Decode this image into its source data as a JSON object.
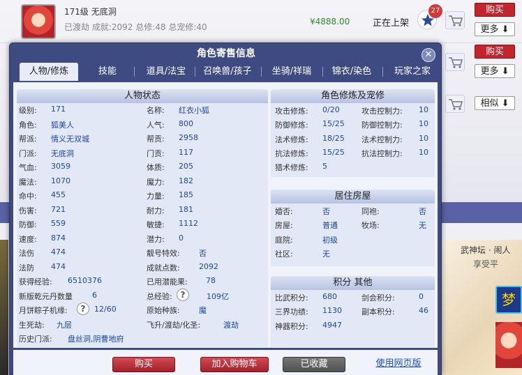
{
  "listing": {
    "title": "171级  无底洞",
    "subtitle": "已渡劫  成就:2092  总修:48  总宠修:40",
    "price": "¥4888.00",
    "status": "正在上架",
    "star_badge": "27",
    "buttons": {
      "buy": "购买",
      "more": "更多",
      "buy2": "购买",
      "more2": "更多",
      "similar": "相似"
    },
    "art_text_1": "武神坛 · 闹人",
    "art_text_2": "享受平",
    "art_icon": "梦"
  },
  "dialog": {
    "title": "角色寄售信息",
    "tabs": [
      "人物/修炼",
      "技能",
      "道具/法宝",
      "召唤兽/孩子",
      "坐骑/祥瑞",
      "锦衣/染色",
      "玩家之家"
    ],
    "active_tab": 0
  },
  "person": {
    "header": "人物状态",
    "left_rows": [
      {
        "label": "级别:",
        "value": "171"
      },
      {
        "label": "角色:",
        "value": "狐美人"
      },
      {
        "label": "帮派:",
        "value": "情义无双城"
      },
      {
        "label": "门派:",
        "value": "无底洞"
      },
      {
        "label": "气血:",
        "value": "3059"
      },
      {
        "label": "魔法:",
        "value": "1070"
      },
      {
        "label": "命中:",
        "value": "455"
      },
      {
        "label": "伤害:",
        "value": "721"
      },
      {
        "label": "防御:",
        "value": "559"
      },
      {
        "label": "速度:",
        "value": "874"
      },
      {
        "label": "法伤",
        "value": "474"
      },
      {
        "label": "法防",
        "value": "474"
      }
    ],
    "right_rows": [
      {
        "label": "名称:",
        "value": "红衣小狐"
      },
      {
        "label": "人气:",
        "value": "800"
      },
      {
        "label": "帮贡:",
        "value": "2958"
      },
      {
        "label": "门贡:",
        "value": "117"
      },
      {
        "label": "体质:",
        "value": "205"
      },
      {
        "label": "魔力:",
        "value": "182"
      },
      {
        "label": "力量:",
        "value": "185"
      },
      {
        "label": "耐力:",
        "value": "181"
      },
      {
        "label": "敏捷:",
        "value": "1112"
      },
      {
        "label": "潜力:",
        "value": "0"
      },
      {
        "label": "靓号特效:",
        "value": "否"
      },
      {
        "label": "成就点数:",
        "value": "2092"
      }
    ],
    "exp_label": "获得经验:",
    "exp_value": "6510376",
    "used_pot_label": "已用潜能果:",
    "used_pot_value": "78",
    "xqd_label": "新版乾元丹数量",
    "xqd_value": "6",
    "total_exp_label": "总经验:",
    "total_exp_value": "109亿",
    "zongzi_label": "月饼粽子机缘:",
    "zongzi_value": "12/60",
    "race_label": "原始种族:",
    "race_value": "魔",
    "life_label": "生死劫:",
    "life_value": "九层",
    "fly_label": "飞升/渡劫/化圣:",
    "fly_value": "渡劫",
    "history_label": "历史门派:",
    "history_value": "盘丝洞,阴曹地府",
    "help_icon_text": "?"
  },
  "cultivation": {
    "header": "角色修炼及宠修",
    "rows": [
      {
        "l1": "攻击修炼:",
        "v1": "0/20",
        "l2": "攻击控制力:",
        "v2": "10"
      },
      {
        "l1": "防御修炼:",
        "v1": "15/25",
        "l2": "防御控制力:",
        "v2": "10"
      },
      {
        "l1": "法术修炼:",
        "v1": "18/25",
        "l2": "法术控制力:",
        "v2": "10"
      },
      {
        "l1": "抗法修炼:",
        "v1": "15/25",
        "l2": "抗法控制力:",
        "v2": "10"
      },
      {
        "l1": "猎术修炼:",
        "v1": "5",
        "l2": "",
        "v2": ""
      }
    ]
  },
  "house": {
    "header": "居住房屋",
    "rows": [
      {
        "l1": "婚否:",
        "v1": "否",
        "l2": "同袍:",
        "v2": "否"
      },
      {
        "l1": "房屋:",
        "v1": "普通",
        "l2": "牧场:",
        "v2": "无"
      },
      {
        "l1": "庭院:",
        "v1": "初级",
        "l2": "",
        "v2": ""
      },
      {
        "l1": "社区:",
        "v1": "无",
        "l2": "",
        "v2": ""
      }
    ]
  },
  "points": {
    "header": "积分 其他",
    "rows": [
      {
        "l1": "比武积分:",
        "v1": "680",
        "l2": "剑会积分:",
        "v2": "0"
      },
      {
        "l1": "三界功绩:",
        "v1": "1130",
        "l2": "副本积分:",
        "v2": "46"
      },
      {
        "l1": "神器积分:",
        "v1": "4947",
        "l2": "",
        "v2": ""
      }
    ]
  },
  "footer": {
    "buy": "购买",
    "add_cart": "加入购物车",
    "collected": "已收藏",
    "web_version": "使用网页版"
  }
}
